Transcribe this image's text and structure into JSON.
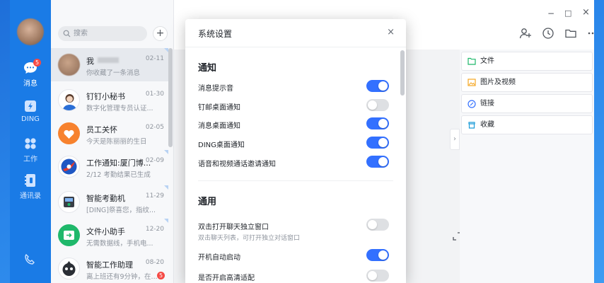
{
  "nav": {
    "items": [
      {
        "label": "消息",
        "icon": "message-icon",
        "badge": "5"
      },
      {
        "label": "DING",
        "icon": "ding-icon"
      },
      {
        "label": "工作",
        "icon": "workbench-icon"
      },
      {
        "label": "通讯录",
        "icon": "contacts-icon"
      }
    ]
  },
  "search": {
    "placeholder": "搜索"
  },
  "conversations": [
    {
      "name": "我",
      "time": "02-11",
      "preview": "你收藏了一条消息"
    },
    {
      "name": "钉钉小秘书",
      "time": "01-30",
      "preview": "数字化管理专员认证..."
    },
    {
      "name": "员工关怀",
      "time": "02-05",
      "preview": "今天是陈丽丽的生日"
    },
    {
      "name": "工作通知:厦门博...",
      "time": "02-09",
      "preview": "2/12 考勤结果已生成"
    },
    {
      "name": "智能考勤机",
      "time": "11-29",
      "preview": "[DING]祭喜您，指纹..."
    },
    {
      "name": "文件小助手",
      "time": "12-20",
      "preview": "无需数据线，手机电..."
    },
    {
      "name": "智能工作助理",
      "time": "08-20",
      "preview": "离上班还有9分钟，在...",
      "badge": "5"
    }
  ],
  "side_panel": {
    "items": [
      {
        "label": "文件",
        "icon": "folder-icon"
      },
      {
        "label": "图片及视频",
        "icon": "image-icon"
      },
      {
        "label": "链接",
        "icon": "link-icon"
      },
      {
        "label": "收藏",
        "icon": "favorite-icon"
      }
    ]
  },
  "dialog": {
    "title": "系统设置",
    "close": "×",
    "sections": [
      {
        "title": "通知",
        "options": [
          {
            "label": "消息提示音",
            "on": true
          },
          {
            "label": "钉邮桌面通知",
            "on": false
          },
          {
            "label": "消息桌面通知",
            "on": true
          },
          {
            "label": "DING桌面通知",
            "on": true
          },
          {
            "label": "语音和视频通话邀请通知",
            "on": true
          }
        ]
      },
      {
        "title": "通用",
        "options": [
          {
            "label": "双击打开聊天独立窗口",
            "sub": "双击聊天列表，可打开独立对话窗口",
            "on": false
          },
          {
            "label": "开机自动启动",
            "on": true
          },
          {
            "label": "是否开启高清适配",
            "on": false
          }
        ]
      }
    ]
  },
  "window_controls": {
    "minimize": "−",
    "maximize": "□",
    "close": "×"
  },
  "colors": {
    "accent": "#3370ff",
    "nav_bg": "#1a7be6",
    "badge": "#f54a45"
  }
}
